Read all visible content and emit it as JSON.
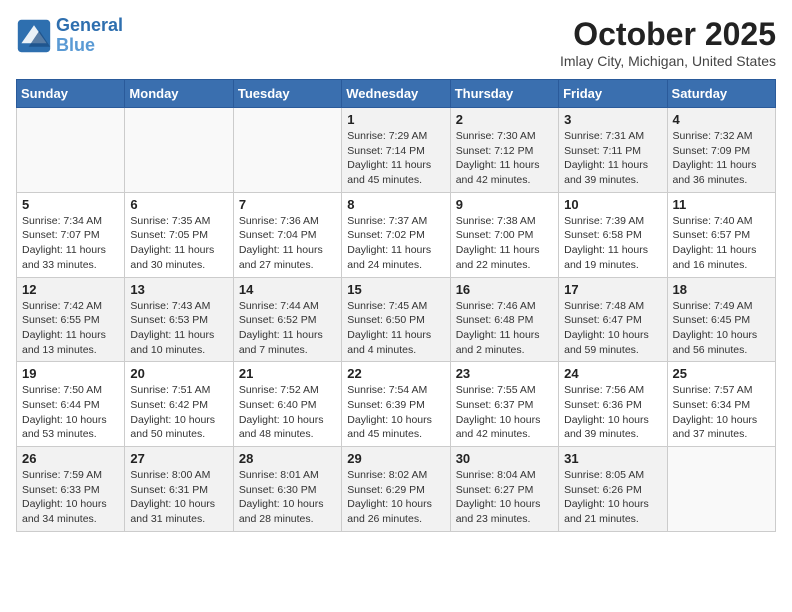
{
  "header": {
    "logo_line1": "General",
    "logo_line2": "Blue",
    "month": "October 2025",
    "location": "Imlay City, Michigan, United States"
  },
  "days_of_week": [
    "Sunday",
    "Monday",
    "Tuesday",
    "Wednesday",
    "Thursday",
    "Friday",
    "Saturday"
  ],
  "weeks": [
    [
      {
        "day": "",
        "info": ""
      },
      {
        "day": "",
        "info": ""
      },
      {
        "day": "",
        "info": ""
      },
      {
        "day": "1",
        "info": "Sunrise: 7:29 AM\nSunset: 7:14 PM\nDaylight: 11 hours\nand 45 minutes."
      },
      {
        "day": "2",
        "info": "Sunrise: 7:30 AM\nSunset: 7:12 PM\nDaylight: 11 hours\nand 42 minutes."
      },
      {
        "day": "3",
        "info": "Sunrise: 7:31 AM\nSunset: 7:11 PM\nDaylight: 11 hours\nand 39 minutes."
      },
      {
        "day": "4",
        "info": "Sunrise: 7:32 AM\nSunset: 7:09 PM\nDaylight: 11 hours\nand 36 minutes."
      }
    ],
    [
      {
        "day": "5",
        "info": "Sunrise: 7:34 AM\nSunset: 7:07 PM\nDaylight: 11 hours\nand 33 minutes."
      },
      {
        "day": "6",
        "info": "Sunrise: 7:35 AM\nSunset: 7:05 PM\nDaylight: 11 hours\nand 30 minutes."
      },
      {
        "day": "7",
        "info": "Sunrise: 7:36 AM\nSunset: 7:04 PM\nDaylight: 11 hours\nand 27 minutes."
      },
      {
        "day": "8",
        "info": "Sunrise: 7:37 AM\nSunset: 7:02 PM\nDaylight: 11 hours\nand 24 minutes."
      },
      {
        "day": "9",
        "info": "Sunrise: 7:38 AM\nSunset: 7:00 PM\nDaylight: 11 hours\nand 22 minutes."
      },
      {
        "day": "10",
        "info": "Sunrise: 7:39 AM\nSunset: 6:58 PM\nDaylight: 11 hours\nand 19 minutes."
      },
      {
        "day": "11",
        "info": "Sunrise: 7:40 AM\nSunset: 6:57 PM\nDaylight: 11 hours\nand 16 minutes."
      }
    ],
    [
      {
        "day": "12",
        "info": "Sunrise: 7:42 AM\nSunset: 6:55 PM\nDaylight: 11 hours\nand 13 minutes."
      },
      {
        "day": "13",
        "info": "Sunrise: 7:43 AM\nSunset: 6:53 PM\nDaylight: 11 hours\nand 10 minutes."
      },
      {
        "day": "14",
        "info": "Sunrise: 7:44 AM\nSunset: 6:52 PM\nDaylight: 11 hours\nand 7 minutes."
      },
      {
        "day": "15",
        "info": "Sunrise: 7:45 AM\nSunset: 6:50 PM\nDaylight: 11 hours\nand 4 minutes."
      },
      {
        "day": "16",
        "info": "Sunrise: 7:46 AM\nSunset: 6:48 PM\nDaylight: 11 hours\nand 2 minutes."
      },
      {
        "day": "17",
        "info": "Sunrise: 7:48 AM\nSunset: 6:47 PM\nDaylight: 10 hours\nand 59 minutes."
      },
      {
        "day": "18",
        "info": "Sunrise: 7:49 AM\nSunset: 6:45 PM\nDaylight: 10 hours\nand 56 minutes."
      }
    ],
    [
      {
        "day": "19",
        "info": "Sunrise: 7:50 AM\nSunset: 6:44 PM\nDaylight: 10 hours\nand 53 minutes."
      },
      {
        "day": "20",
        "info": "Sunrise: 7:51 AM\nSunset: 6:42 PM\nDaylight: 10 hours\nand 50 minutes."
      },
      {
        "day": "21",
        "info": "Sunrise: 7:52 AM\nSunset: 6:40 PM\nDaylight: 10 hours\nand 48 minutes."
      },
      {
        "day": "22",
        "info": "Sunrise: 7:54 AM\nSunset: 6:39 PM\nDaylight: 10 hours\nand 45 minutes."
      },
      {
        "day": "23",
        "info": "Sunrise: 7:55 AM\nSunset: 6:37 PM\nDaylight: 10 hours\nand 42 minutes."
      },
      {
        "day": "24",
        "info": "Sunrise: 7:56 AM\nSunset: 6:36 PM\nDaylight: 10 hours\nand 39 minutes."
      },
      {
        "day": "25",
        "info": "Sunrise: 7:57 AM\nSunset: 6:34 PM\nDaylight: 10 hours\nand 37 minutes."
      }
    ],
    [
      {
        "day": "26",
        "info": "Sunrise: 7:59 AM\nSunset: 6:33 PM\nDaylight: 10 hours\nand 34 minutes."
      },
      {
        "day": "27",
        "info": "Sunrise: 8:00 AM\nSunset: 6:31 PM\nDaylight: 10 hours\nand 31 minutes."
      },
      {
        "day": "28",
        "info": "Sunrise: 8:01 AM\nSunset: 6:30 PM\nDaylight: 10 hours\nand 28 minutes."
      },
      {
        "day": "29",
        "info": "Sunrise: 8:02 AM\nSunset: 6:29 PM\nDaylight: 10 hours\nand 26 minutes."
      },
      {
        "day": "30",
        "info": "Sunrise: 8:04 AM\nSunset: 6:27 PM\nDaylight: 10 hours\nand 23 minutes."
      },
      {
        "day": "31",
        "info": "Sunrise: 8:05 AM\nSunset: 6:26 PM\nDaylight: 10 hours\nand 21 minutes."
      },
      {
        "day": "",
        "info": ""
      }
    ]
  ]
}
